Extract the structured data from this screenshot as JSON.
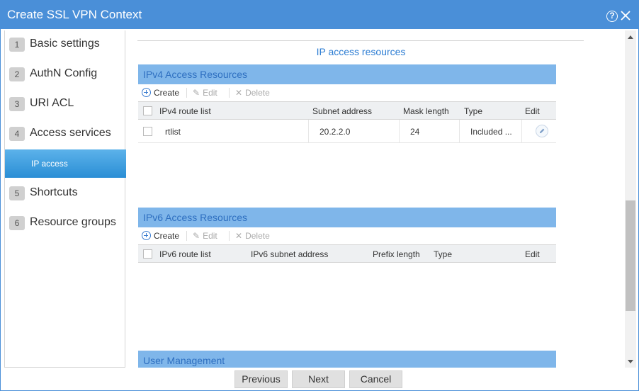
{
  "window": {
    "title": "Create SSL VPN Context"
  },
  "steps": [
    {
      "num": "1",
      "label": "Basic settings"
    },
    {
      "num": "2",
      "label": "AuthN Config"
    },
    {
      "num": "3",
      "label": "URI ACL"
    },
    {
      "num": "4",
      "label": "Access services"
    },
    {
      "sub": "IP access"
    },
    {
      "num": "5",
      "label": "Shortcuts"
    },
    {
      "num": "6",
      "label": "Resource groups"
    }
  ],
  "section_title": "IP access resources",
  "ipv4": {
    "title": "IPv4 Access Resources",
    "toolbar": {
      "create": "Create",
      "edit": "Edit",
      "delete": "Delete"
    },
    "columns": [
      "IPv4 route list",
      "Subnet address",
      "Mask length",
      "Type",
      "Edit"
    ],
    "rows": [
      {
        "route": "rtlist",
        "subnet": "20.2.2.0",
        "mask": "24",
        "type": "Included ..."
      }
    ]
  },
  "ipv6": {
    "title": "IPv6 Access Resources",
    "toolbar": {
      "create": "Create",
      "edit": "Edit",
      "delete": "Delete"
    },
    "columns": [
      "IPv6 route list",
      "IPv6 subnet address",
      "Prefix length",
      "Type",
      "Edit"
    ]
  },
  "user_mgmt": {
    "title": "User Management"
  },
  "footer": {
    "previous": "Previous",
    "next": "Next",
    "cancel": "Cancel"
  },
  "colors": {
    "titlebar": "#4a8fd8",
    "panel_head": "#7fb6ea",
    "active_step": "#2a8ed5",
    "link": "#2b7cd3"
  },
  "icons": [
    "help-icon",
    "close-icon",
    "plus-circle-icon",
    "pencil-icon",
    "x-icon",
    "edit-pencil-icon",
    "scroll-up-icon",
    "scroll-down-icon"
  ]
}
